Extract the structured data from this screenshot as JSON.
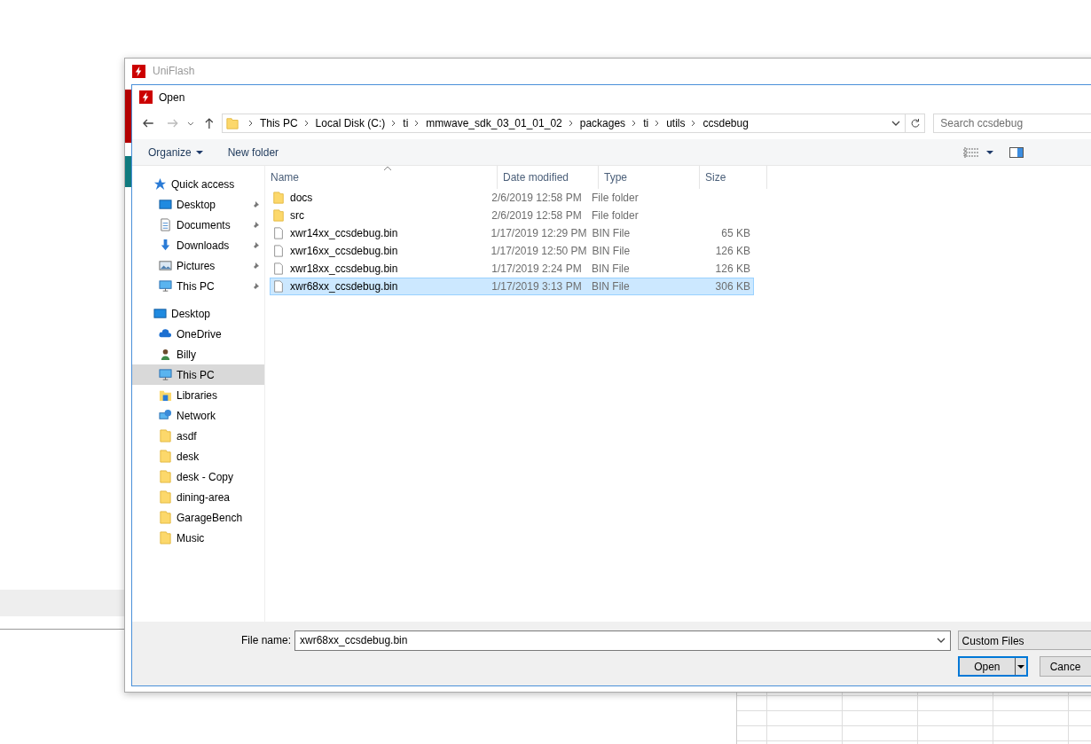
{
  "app_window": {
    "title": "UniFlash"
  },
  "dialog": {
    "title": "Open"
  },
  "breadcrumbs": [
    "This PC",
    "Local Disk (C:)",
    "ti",
    "mmwave_sdk_03_01_01_02",
    "packages",
    "ti",
    "utils",
    "ccsdebug"
  ],
  "search": {
    "placeholder": "Search ccsdebug"
  },
  "toolbar": {
    "organize": "Organize",
    "new_folder": "New folder"
  },
  "sidebar": {
    "items": [
      {
        "label": "Quick access",
        "kind": "star",
        "selected": false,
        "children": [
          {
            "label": "Desktop",
            "kind": "desktop",
            "pinned": true,
            "selected": false
          },
          {
            "label": "Documents",
            "kind": "documents",
            "pinned": true,
            "selected": false
          },
          {
            "label": "Downloads",
            "kind": "downloads",
            "pinned": true,
            "selected": false
          },
          {
            "label": "Pictures",
            "kind": "pictures",
            "pinned": true,
            "selected": false
          },
          {
            "label": "This PC",
            "kind": "pc",
            "pinned": true,
            "selected": false
          }
        ]
      },
      {
        "label": "Desktop",
        "kind": "desktop",
        "selected": false,
        "children": [
          {
            "label": "OneDrive",
            "kind": "cloud",
            "pinned": false,
            "selected": false
          },
          {
            "label": "Billy",
            "kind": "user",
            "pinned": false,
            "selected": false
          },
          {
            "label": "This PC",
            "kind": "pc",
            "pinned": false,
            "selected": true
          },
          {
            "label": "Libraries",
            "kind": "libraries",
            "pinned": false,
            "selected": false
          },
          {
            "label": "Network",
            "kind": "network",
            "pinned": false,
            "selected": false
          },
          {
            "label": "asdf",
            "kind": "folder",
            "pinned": false,
            "selected": false
          },
          {
            "label": "desk",
            "kind": "folder",
            "pinned": false,
            "selected": false
          },
          {
            "label": "desk - Copy",
            "kind": "folder",
            "pinned": false,
            "selected": false
          },
          {
            "label": "dining-area",
            "kind": "folder",
            "pinned": false,
            "selected": false
          },
          {
            "label": "GarageBench",
            "kind": "folder",
            "pinned": false,
            "selected": false
          },
          {
            "label": "Music",
            "kind": "folder",
            "pinned": false,
            "selected": false
          }
        ]
      }
    ]
  },
  "table": {
    "columns": [
      "Name",
      "Date modified",
      "Type",
      "Size"
    ],
    "rows": [
      {
        "kind": "folder",
        "name": "docs",
        "date": "2/6/2019 12:58 PM",
        "type": "File folder",
        "size": "",
        "selected": false
      },
      {
        "kind": "folder",
        "name": "src",
        "date": "2/6/2019 12:58 PM",
        "type": "File folder",
        "size": "",
        "selected": false
      },
      {
        "kind": "file",
        "name": "xwr14xx_ccsdebug.bin",
        "date": "1/17/2019 12:29 PM",
        "type": "BIN File",
        "size": "65 KB",
        "selected": false
      },
      {
        "kind": "file",
        "name": "xwr16xx_ccsdebug.bin",
        "date": "1/17/2019 12:50 PM",
        "type": "BIN File",
        "size": "126 KB",
        "selected": false
      },
      {
        "kind": "file",
        "name": "xwr18xx_ccsdebug.bin",
        "date": "1/17/2019 2:24 PM",
        "type": "BIN File",
        "size": "126 KB",
        "selected": false
      },
      {
        "kind": "file",
        "name": "xwr68xx_ccsdebug.bin",
        "date": "1/17/2019 3:13 PM",
        "type": "BIN File",
        "size": "306 KB",
        "selected": true
      }
    ]
  },
  "footer": {
    "file_name_label": "File name:",
    "file_name": "xwr68xx_ccsdebug.bin",
    "filter": "Custom Files",
    "open": "Open",
    "cancel": "Cance"
  }
}
